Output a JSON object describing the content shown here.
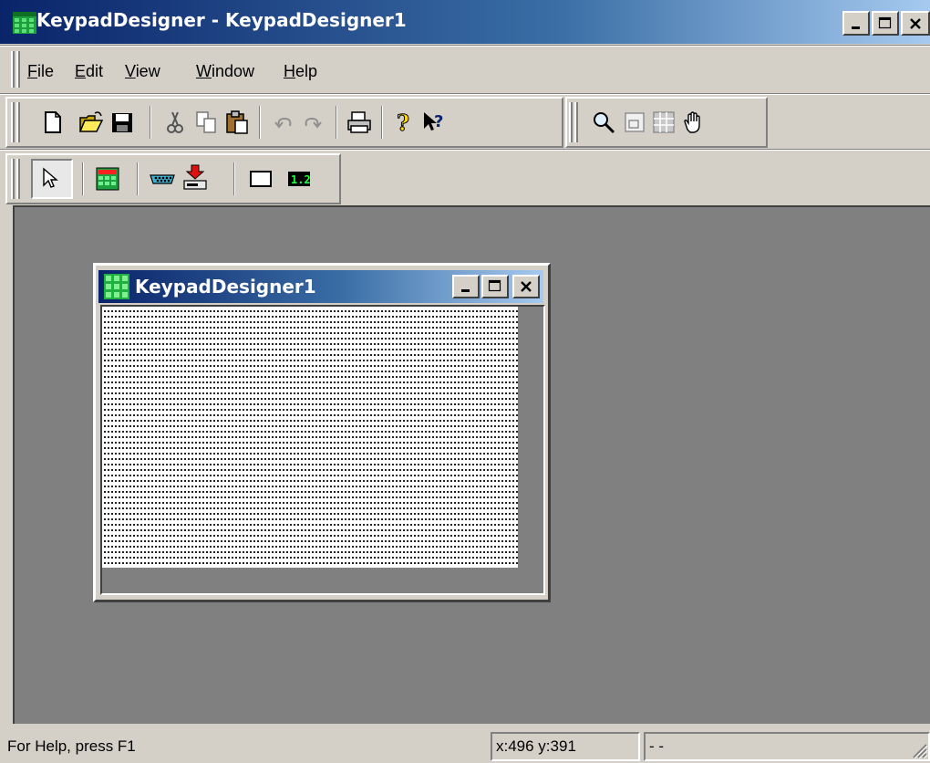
{
  "window": {
    "title": "KeypadDesigner - KeypadDesigner1",
    "caption_icons": [
      "minimize-icon",
      "maximize-icon",
      "close-icon"
    ]
  },
  "menu": {
    "items": [
      {
        "label": "File",
        "underline": "F"
      },
      {
        "label": "Edit",
        "underline": "E"
      },
      {
        "label": "View",
        "underline": "V"
      },
      {
        "label": "Window",
        "underline": "W"
      },
      {
        "label": "Help",
        "underline": "H"
      }
    ]
  },
  "toolbar_standard": {
    "icons": [
      "new-document-icon",
      "open-folder-icon",
      "save-icon",
      "cut-icon",
      "copy-icon",
      "paste-icon",
      "undo-icon",
      "redo-icon",
      "print-icon",
      "about-icon",
      "context-help-icon"
    ]
  },
  "toolbar_view": {
    "icons": [
      "zoom-icon",
      "fit-page-icon",
      "grid-icon",
      "pan-hand-icon"
    ]
  },
  "toolbar_tools": {
    "icons": [
      "pointer-select-icon",
      "keypad-icon",
      "serial-port-icon",
      "download-icon",
      "rectangle-icon",
      "led-display-icon"
    ]
  },
  "child_window": {
    "title": "KeypadDesigner1"
  },
  "status": {
    "help_text": "For Help, press F1",
    "coordinates": "x:496 y:391",
    "mode": "- -"
  },
  "colors": {
    "titlebar_start": "#0a246a",
    "titlebar_end": "#a6caf0",
    "workspace": "#808080",
    "chrome": "#d4d0c8"
  }
}
